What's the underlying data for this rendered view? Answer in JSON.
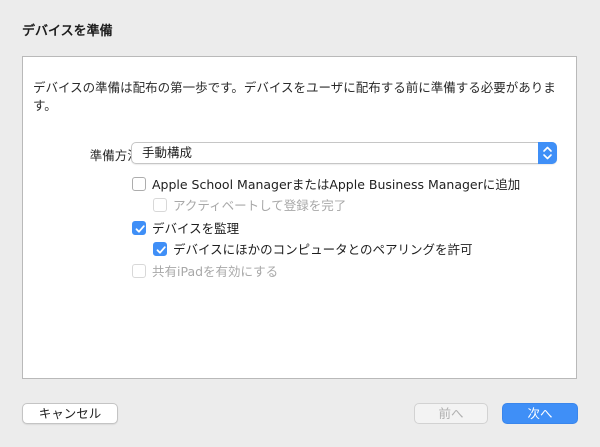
{
  "dialog": {
    "title": "デバイスを準備"
  },
  "panel": {
    "description": "デバイスの準備は配布の第一歩です。デバイスをユーザに配布する前に準備する必要があります。",
    "method_label": "準備方法:",
    "method_value": "手動構成",
    "options": [
      {
        "label": "Apple School ManagerまたはApple Business Managerに追加",
        "checked": false,
        "disabled": false
      },
      {
        "label": "アクティベートして登録を完了",
        "checked": false,
        "disabled": true
      },
      {
        "label": "デバイスを監理",
        "checked": true,
        "disabled": false
      },
      {
        "label": "デバイスにほかのコンピュータとのペアリングを許可",
        "checked": true,
        "disabled": false
      },
      {
        "label": "共有iPadを有効にする",
        "checked": false,
        "disabled": true
      }
    ]
  },
  "buttons": {
    "cancel": "キャンセル",
    "previous": "前へ",
    "next": "次へ"
  },
  "colors": {
    "accent": "#3f8ff7",
    "background": "#ececec",
    "disabled_text": "#a8a8a8"
  },
  "icons": {
    "checkmark": "checkmark-icon",
    "select_arrows": "chevron-up-down-icon"
  }
}
